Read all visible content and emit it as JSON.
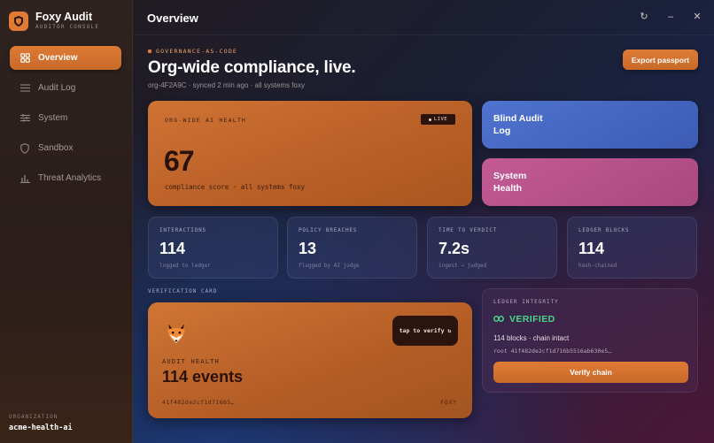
{
  "app": {
    "title": "Foxy Audit",
    "subtitle": "AUDITOR CONSOLE"
  },
  "sidebar": {
    "items": [
      {
        "label": "Overview",
        "icon": "grid-icon"
      },
      {
        "label": "Audit Log",
        "icon": "list-icon"
      },
      {
        "label": "System",
        "icon": "sliders-icon"
      },
      {
        "label": "Sandbox",
        "icon": "shield-icon"
      },
      {
        "label": "Threat Analytics",
        "icon": "bar-chart-icon"
      }
    ],
    "org_label": "ORGANIZATION",
    "org_value": "acme-health-ai"
  },
  "topbar": {
    "title": "Overview",
    "controls": {
      "refresh": "↻",
      "minimize": "–",
      "close": "✕"
    }
  },
  "header": {
    "kicker": "GOVERNANCE-AS-CODE",
    "headline": "Org-wide compliance, live.",
    "subline": "org-4F2A9C · synced 2 min ago · all systems foxy",
    "export_label": "Export passport"
  },
  "health": {
    "label": "ORG-WIDE AI HEALTH",
    "badge": "LIVE",
    "score": "67",
    "caption": "compliance score · all systems foxy"
  },
  "quick_cards": [
    {
      "line1": "Blind Audit",
      "line2": "Log"
    },
    {
      "line1": "System",
      "line2": "Health"
    }
  ],
  "stats": [
    {
      "label": "INTERACTIONS",
      "value": "114",
      "sub": "logged to ledger"
    },
    {
      "label": "POLICY BREACHES",
      "value": "13",
      "sub": "flagged by AI judge"
    },
    {
      "label": "TIME TO VERDICT",
      "value": "7.2s",
      "sub": "ingest → judged"
    },
    {
      "label": "LEDGER BLOCKS",
      "value": "114",
      "sub": "hash-chained"
    }
  ],
  "verification": {
    "section_label": "VERIFICATION CARD",
    "tap_label": "tap to verify ↻",
    "kicker": "AUDIT HEALTH",
    "title": "114 events",
    "hash": "41f482de2cf1d716b5…",
    "brand": "FOXY"
  },
  "ledger": {
    "label": "LEDGER INTEGRITY",
    "status": "VERIFIED",
    "detail": "114 blocks · chain intact",
    "root": "root 41f482de2cf1d716b5516ab630e5…",
    "button_label": "Verify chain"
  },
  "colors": {
    "accent": "#de7a34",
    "success": "#4bd68a",
    "blue_card": "#4f73cf",
    "pink_card": "#c35a95"
  }
}
